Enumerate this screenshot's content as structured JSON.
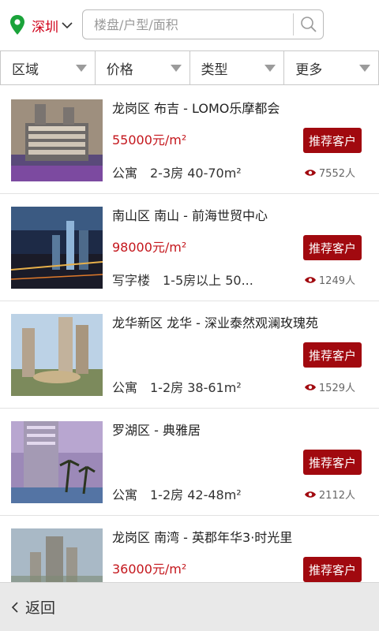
{
  "header": {
    "city": "深圳",
    "search_placeholder": "楼盘/户型/面积"
  },
  "filters": [
    {
      "label": "区域"
    },
    {
      "label": "价格"
    },
    {
      "label": "类型"
    },
    {
      "label": "更多"
    }
  ],
  "listings": [
    {
      "title": "龙岗区 布吉 - LOMO乐摩都会",
      "price": "55000元/m²",
      "meta": "公寓　2-3房 40-70m²",
      "recommend_label": "推荐客户",
      "views": "7552人"
    },
    {
      "title": "南山区 南山 - 前海世贸中心",
      "price": "98000元/m²",
      "meta": "写字楼　1-5房以上 50...",
      "recommend_label": "推荐客户",
      "views": "1249人"
    },
    {
      "title": "龙华新区 龙华 - 深业泰然观澜玫瑰苑",
      "price": "",
      "meta": "公寓　1-2房 38-61m²",
      "recommend_label": "推荐客户",
      "views": "1529人"
    },
    {
      "title": "罗湖区  - 典雅居",
      "price": "",
      "meta": "公寓　1-2房 42-48m²",
      "recommend_label": "推荐客户",
      "views": "2112人"
    },
    {
      "title": "龙岗区 南湾 - 英郡年华3·时光里",
      "price": "36000元/m²",
      "meta": "",
      "recommend_label": "推荐客户",
      "views": ""
    }
  ],
  "footer": {
    "back_label": "返回"
  },
  "colors": {
    "accent_red": "#c4161c",
    "button_red": "#a1090f",
    "pin_green": "#1aa33a"
  },
  "icons": [
    "location-pin-icon",
    "chevron-down-icon",
    "search-icon",
    "dropdown-triangle-icon",
    "eye-icon",
    "back-chevron-icon"
  ]
}
